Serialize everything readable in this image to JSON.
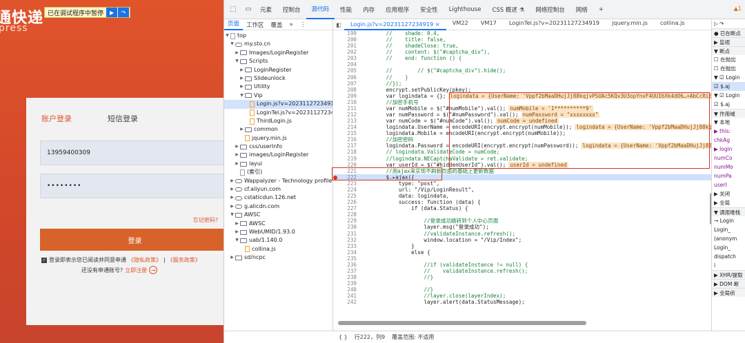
{
  "login": {
    "brand_cn": "通快递",
    "brand_en": "press",
    "pause_text": "已在调试程序中暂停",
    "tab_account": "账户登录",
    "tab_sms": "短信登录",
    "username": "13959400309",
    "password_mask": "••••••••",
    "forgot": "忘记密码?",
    "login_button": "登录",
    "agree_text": "登录即表示您已阅读并同意申通",
    "privacy_link": "《隐私政策》",
    "sep": "|",
    "service_link": "《服务政策》",
    "register_text": "还没有申通账号?",
    "register_link": "立即注册"
  },
  "devtools": {
    "top_tabs": [
      "元素",
      "控制台",
      "源代码",
      "性能",
      "内存",
      "应用程序",
      "安全性",
      "Lighthouse",
      "CSS 概述 ⚗",
      "网络控制台",
      "网络",
      "+"
    ],
    "active_tab": "源代码",
    "warning": "▲1",
    "nav_tabs": [
      "页面",
      "工作区",
      "覆盖",
      "»",
      "⋮"
    ],
    "tree": [
      {
        "indent": 0,
        "arrow": "▼",
        "icon": "fl",
        "label": "top"
      },
      {
        "indent": 1,
        "arrow": "▼",
        "icon": "cloud",
        "label": "my.sto.cn"
      },
      {
        "indent": 2,
        "arrow": "▶",
        "icon": "fld",
        "label": "Images/LoginRegister"
      },
      {
        "indent": 2,
        "arrow": "▼",
        "icon": "fld",
        "label": "Scripts"
      },
      {
        "indent": 3,
        "arrow": "▶",
        "icon": "fld",
        "label": "LoginRegister"
      },
      {
        "indent": 3,
        "arrow": "▶",
        "icon": "fld",
        "label": "Slideunlock"
      },
      {
        "indent": 3,
        "arrow": "▶",
        "icon": "fld",
        "label": "Utility"
      },
      {
        "indent": 3,
        "arrow": "▼",
        "icon": "fld",
        "label": "Vip"
      },
      {
        "indent": 4,
        "arrow": "",
        "icon": "js",
        "label": "Login.js?v=20231127234919",
        "sel": true
      },
      {
        "indent": 4,
        "arrow": "",
        "icon": "js",
        "label": "LoginTel.js?v=20231127234919"
      },
      {
        "indent": 4,
        "arrow": "",
        "icon": "js",
        "label": "ThirdLogin.js"
      },
      {
        "indent": 3,
        "arrow": "▶",
        "icon": "fld",
        "label": "common"
      },
      {
        "indent": 3,
        "arrow": "",
        "icon": "js",
        "label": "jquery.min.js"
      },
      {
        "indent": 2,
        "arrow": "▶",
        "icon": "fld",
        "label": "css/userInfo"
      },
      {
        "indent": 2,
        "arrow": "▶",
        "icon": "fld",
        "label": "images/LoginRegister"
      },
      {
        "indent": 2,
        "arrow": "▶",
        "icon": "fld",
        "label": "layui"
      },
      {
        "indent": 2,
        "arrow": "",
        "icon": "fl",
        "label": "(索引)"
      },
      {
        "indent": 1,
        "arrow": "▶",
        "icon": "cloud",
        "label": "Wappalyzer - Technology profiler"
      },
      {
        "indent": 1,
        "arrow": "▶",
        "icon": "cloud",
        "label": "cf.aliyun.com"
      },
      {
        "indent": 1,
        "arrow": "▶",
        "icon": "cloud",
        "label": "cstaticdun.126.net"
      },
      {
        "indent": 1,
        "arrow": "▶",
        "icon": "cloud",
        "label": "g.alicdn.com"
      },
      {
        "indent": 1,
        "arrow": "▼",
        "icon": "fld",
        "label": "AWSC"
      },
      {
        "indent": 2,
        "arrow": "▶",
        "icon": "fld",
        "label": "AWSC"
      },
      {
        "indent": 2,
        "arrow": "▶",
        "icon": "fld",
        "label": "WebUMID/1.93.0"
      },
      {
        "indent": 2,
        "arrow": "▼",
        "icon": "fld",
        "label": "uab/1.140.0"
      },
      {
        "indent": 3,
        "arrow": "",
        "icon": "js",
        "label": "collina.js"
      },
      {
        "indent": 1,
        "arrow": "▶",
        "icon": "fld",
        "label": "sd/ncpc"
      }
    ],
    "file_tabs": [
      "Login.js?v=20231127234919 ×",
      "VM22",
      "VM17",
      "LoginTel.js?v=20231127234919",
      "jquery.min.js",
      "collina.js"
    ],
    "code": [
      {
        "n": "199",
        "t": "        //    shade: 0.4,",
        "c": true
      },
      {
        "n": "200",
        "t": "        //    title: false,",
        "c": true
      },
      {
        "n": "201",
        "t": "        //    shadeClose: true,",
        "c": true
      },
      {
        "n": "202",
        "t": "        //    content: $(\"#captcha_div\"),",
        "c": true
      },
      {
        "n": "203",
        "t": "        //    end: function () {",
        "c": true
      },
      {
        "n": "204",
        "t": ""
      },
      {
        "n": "205",
        "t": "        //        // $(\"#captcha_div\").hide();",
        "c": true
      },
      {
        "n": "206",
        "t": "        //    }",
        "c": true
      },
      {
        "n": "207",
        "t": "        //});",
        "c": true
      },
      {
        "n": "208",
        "t": "        encrypt.setPublicKey(pkey);"
      },
      {
        "n": "209",
        "t": "        var logindata = {};",
        "v": "logindata = {UserName: 'Vppf2bMaaDHujJj88kqjvPSUAc5KQv3U3opYnvF4UUI6Xk4dO6…+AbCcRiE03"
      },
      {
        "n": "210",
        "t": "        //加密手机号",
        "c": true
      },
      {
        "n": "211",
        "t": "        var numMobile = $(\"#numMobile\").val();",
        "v": "numMobile = '1**********9'"
      },
      {
        "n": "212",
        "t": "        var numPassword = $(\"#numPassword\").val();",
        "v": "numPassword = \"xxxxxxxx\""
      },
      {
        "n": "213",
        "t": "        var numCode = $(\"#numCode\").val();",
        "v": "numCode = undefined"
      },
      {
        "n": "214",
        "t": "        logindata.UserName = encodeURI(encrypt.encrypt(numMobile));",
        "v": "logindata = {UserName: 'Vppf2bMaaDHujJj88kqjv"
      },
      {
        "n": "215",
        "t": "        logindata.Mobile = encodeURI(encrypt.encrypt(numMobile));"
      },
      {
        "n": "216",
        "t": "        //加密密码",
        "c": true
      },
      {
        "n": "217",
        "t": "        logindata.Password = encodeURI(encrypt.encrypt(numPassword));",
        "v": "logindata = {UserName: 'Vppf2bMaaDHujJj88kq"
      },
      {
        "n": "218",
        "t": "        // logindata.ValidateCode = numCode;",
        "c": true
      },
      {
        "n": "219",
        "t": "        //logindata.NECaptchaValidate = ret.validate;",
        "c": true
      },
      {
        "n": "220",
        "t": "        var userId = $(\"#hiddenUserId\").val();",
        "v": "userId = undefined"
      },
      {
        "n": "221",
        "t": "        //用ajax来实现不刷新页面的基础上更新数据",
        "c": true
      },
      {
        "n": "222",
        "t": "        $.▸ajax({",
        "exec": true,
        "bp": true
      },
      {
        "n": "223",
        "t": "            type: \"post\","
      },
      {
        "n": "224",
        "t": "            url: \"/Vip/LoginResult\","
      },
      {
        "n": "225",
        "t": "            data: logindata,"
      },
      {
        "n": "226",
        "t": "            success: function (data) {"
      },
      {
        "n": "227",
        "t": "                if (data.Status) {"
      },
      {
        "n": "228",
        "t": ""
      },
      {
        "n": "229",
        "t": "                    //登录成功跳转到个人中心页面",
        "c": true
      },
      {
        "n": "230",
        "t": "                    layer.msg(\"登录成功\");"
      },
      {
        "n": "231",
        "t": "                    //validateInstance.refresh();",
        "c": true
      },
      {
        "n": "232",
        "t": "                    window.location = \"/Vip/Index\";"
      },
      {
        "n": "233",
        "t": "                }"
      },
      {
        "n": "234",
        "t": "                else {"
      },
      {
        "n": "235",
        "t": ""
      },
      {
        "n": "236",
        "t": "                    //if (validateInstance != null) {",
        "c": true
      },
      {
        "n": "237",
        "t": "                    //    validateInstance.refresh();",
        "c": true
      },
      {
        "n": "238",
        "t": "                    //}",
        "c": true
      },
      {
        "n": "239",
        "t": ""
      },
      {
        "n": "240",
        "t": "                    //}",
        "c": true
      },
      {
        "n": "241",
        "t": "                    //layer.close(layerIndex);",
        "c": true
      },
      {
        "n": "242",
        "t": "                    layer.alert(data.StatusMessage);"
      }
    ],
    "status": {
      "braces": "{ }",
      "position": "行222，列9",
      "coverage": "覆盖范围: 不适用"
    },
    "debug_rows": [
      {
        "t": "▷ ↷",
        "cls": ""
      },
      {
        "t": "● 已在断点",
        "cls": "head"
      },
      {
        "t": "▶ 监视",
        "cls": "head"
      },
      {
        "t": "▼ 断点",
        "cls": "head"
      },
      {
        "t": "☐ 在抛出",
        "cls": ""
      },
      {
        "t": "☐ 在抛出",
        "cls": ""
      },
      {
        "t": "▼ ☑ Login",
        "cls": ""
      },
      {
        "t": "  ☑ $.aj",
        "cls": "sel"
      },
      {
        "t": "▼ ☑ Login",
        "cls": ""
      },
      {
        "t": "  ☑ $.aj",
        "cls": ""
      },
      {
        "t": "▼ 作用域",
        "cls": "head"
      },
      {
        "t": "▼ 本地",
        "cls": ""
      },
      {
        "t": " ▶ this:",
        "cls": "blue"
      },
      {
        "t": "   chkAg",
        "cls": "blue"
      },
      {
        "t": " ▶ login",
        "cls": "blue"
      },
      {
        "t": "   numCo",
        "cls": "blue"
      },
      {
        "t": "   numMo",
        "cls": "blue"
      },
      {
        "t": "   numPa",
        "cls": "blue"
      },
      {
        "t": "   userI",
        "cls": "blue"
      },
      {
        "t": "▶ 关闭",
        "cls": ""
      },
      {
        "t": "▶ 全局",
        "cls": ""
      },
      {
        "t": "▼ 调用堆栈",
        "cls": "head"
      },
      {
        "t": "→ Login",
        "cls": ""
      },
      {
        "t": "   Login_",
        "cls": ""
      },
      {
        "t": " (anonym",
        "cls": ""
      },
      {
        "t": "   Login_",
        "cls": ""
      },
      {
        "t": " dispatch",
        "cls": ""
      },
      {
        "t": " i",
        "cls": ""
      },
      {
        "t": "▶ XHR/提取",
        "cls": "head"
      },
      {
        "t": "▶ DOM 断",
        "cls": "head"
      },
      {
        "t": "▶ 全局侦",
        "cls": "head"
      }
    ]
  }
}
